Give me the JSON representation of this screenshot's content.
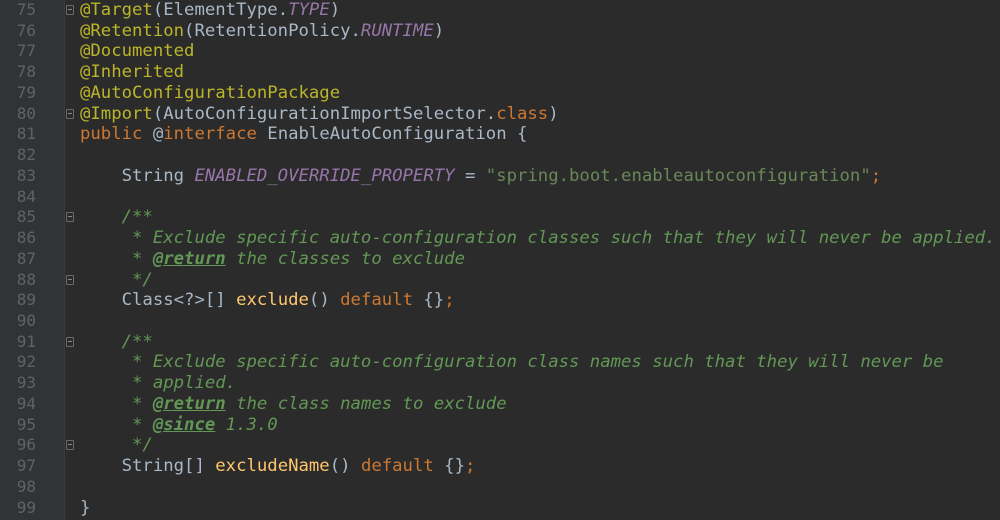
{
  "lines": [
    {
      "n": "75",
      "fold": true,
      "tokens": [
        [
          "ann",
          "@Target"
        ],
        [
          "plain",
          "(ElementType."
        ],
        [
          "field",
          "TYPE"
        ],
        [
          "plain",
          ")"
        ]
      ]
    },
    {
      "n": "76",
      "fold": false,
      "tokens": [
        [
          "ann",
          "@Retention"
        ],
        [
          "plain",
          "(RetentionPolicy."
        ],
        [
          "field",
          "RUNTIME"
        ],
        [
          "plain",
          ")"
        ]
      ]
    },
    {
      "n": "77",
      "fold": false,
      "tokens": [
        [
          "ann",
          "@Documented"
        ]
      ]
    },
    {
      "n": "78",
      "fold": false,
      "tokens": [
        [
          "ann",
          "@Inherited"
        ]
      ]
    },
    {
      "n": "79",
      "fold": false,
      "tokens": [
        [
          "ann",
          "@AutoConfigurationPackage"
        ]
      ]
    },
    {
      "n": "80",
      "fold": true,
      "tokens": [
        [
          "ann",
          "@Import"
        ],
        [
          "plain",
          "(AutoConfigurationImportSelector."
        ],
        [
          "kw",
          "class"
        ],
        [
          "plain",
          ")"
        ]
      ]
    },
    {
      "n": "81",
      "fold": false,
      "tokens": [
        [
          "kw",
          "public "
        ],
        [
          "plain",
          "@"
        ],
        [
          "kw",
          "interface "
        ],
        [
          "plain",
          "EnableAutoConfiguration {"
        ]
      ]
    },
    {
      "n": "82",
      "fold": false,
      "tokens": []
    },
    {
      "n": "83",
      "fold": false,
      "tokens": [
        [
          "plain",
          "    String "
        ],
        [
          "field",
          "ENABLED_OVERRIDE_PROPERTY"
        ],
        [
          "plain",
          " = "
        ],
        [
          "str",
          "\"spring.boot.enableautoconfiguration\""
        ],
        [
          "kw",
          ";"
        ]
      ]
    },
    {
      "n": "84",
      "fold": false,
      "tokens": []
    },
    {
      "n": "85",
      "fold": true,
      "tokens": [
        [
          "doc",
          "    /**"
        ]
      ]
    },
    {
      "n": "86",
      "fold": false,
      "tokens": [
        [
          "doc",
          "     * Exclude specific auto-configuration classes such that they will never be applied."
        ]
      ]
    },
    {
      "n": "87",
      "fold": false,
      "tokens": [
        [
          "doc",
          "     * "
        ],
        [
          "doctag",
          "@return"
        ],
        [
          "doc",
          " the classes to exclude"
        ]
      ]
    },
    {
      "n": "88",
      "fold": true,
      "tokens": [
        [
          "doc",
          "     */"
        ]
      ]
    },
    {
      "n": "89",
      "fold": false,
      "tokens": [
        [
          "plain",
          "    Class<?>[] "
        ],
        [
          "method",
          "exclude"
        ],
        [
          "plain",
          "() "
        ],
        [
          "kw",
          "default "
        ],
        [
          "plain",
          "{}"
        ],
        [
          "kw",
          ";"
        ]
      ]
    },
    {
      "n": "90",
      "fold": false,
      "tokens": []
    },
    {
      "n": "91",
      "fold": true,
      "tokens": [
        [
          "doc",
          "    /**"
        ]
      ]
    },
    {
      "n": "92",
      "fold": false,
      "tokens": [
        [
          "doc",
          "     * Exclude specific auto-configuration class names such that they will never be"
        ]
      ]
    },
    {
      "n": "93",
      "fold": false,
      "tokens": [
        [
          "doc",
          "     * applied."
        ]
      ]
    },
    {
      "n": "94",
      "fold": false,
      "tokens": [
        [
          "doc",
          "     * "
        ],
        [
          "doctag",
          "@return"
        ],
        [
          "doc",
          " the class names to exclude"
        ]
      ]
    },
    {
      "n": "95",
      "fold": false,
      "tokens": [
        [
          "doc",
          "     * "
        ],
        [
          "doctag",
          "@since"
        ],
        [
          "doc",
          " 1.3.0"
        ]
      ]
    },
    {
      "n": "96",
      "fold": true,
      "tokens": [
        [
          "doc",
          "     */"
        ]
      ]
    },
    {
      "n": "97",
      "fold": false,
      "tokens": [
        [
          "plain",
          "    String[] "
        ],
        [
          "method",
          "excludeName"
        ],
        [
          "plain",
          "() "
        ],
        [
          "kw",
          "default "
        ],
        [
          "plain",
          "{}"
        ],
        [
          "kw",
          ";"
        ]
      ]
    },
    {
      "n": "98",
      "fold": false,
      "tokens": []
    },
    {
      "n": "99",
      "fold": false,
      "tokens": [
        [
          "plain",
          "}"
        ]
      ]
    }
  ]
}
